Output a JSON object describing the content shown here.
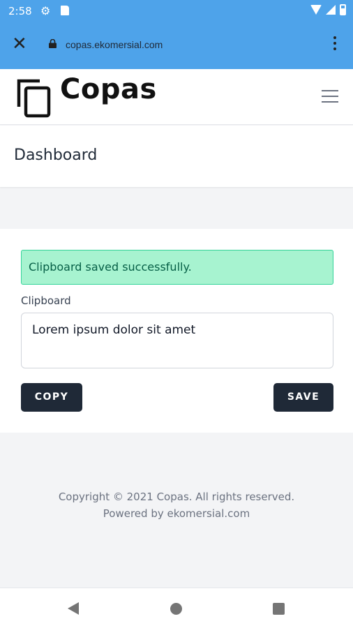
{
  "status_bar": {
    "time": "2:58",
    "icons": [
      "gear-icon",
      "sd-card-icon",
      "wifi-icon",
      "signal-icon",
      "battery-icon"
    ]
  },
  "browser": {
    "url": "copas.ekomersial.com",
    "icons": [
      "close-icon",
      "lock-icon",
      "more-vert-icon"
    ]
  },
  "navbar": {
    "brand": "Copas",
    "icons": [
      "copy-logo-icon",
      "hamburger-menu-icon"
    ]
  },
  "page": {
    "title": "Dashboard"
  },
  "alert": {
    "message": "Clipboard saved successfully.",
    "background": "#a7f3d0",
    "text_color": "#065f46"
  },
  "form": {
    "label": "Clipboard",
    "textarea_value": "Lorem ipsum dolor sit amet",
    "copy_label": "COPY",
    "save_label": "SAVE",
    "button_color": "#1f2937"
  },
  "footer": {
    "copyright": "Copyright © 2021 Copas. All rights reserved.",
    "powered": "Powered by ekomersial.com"
  },
  "theme": {
    "browser_bar": "#4ea3ea"
  }
}
